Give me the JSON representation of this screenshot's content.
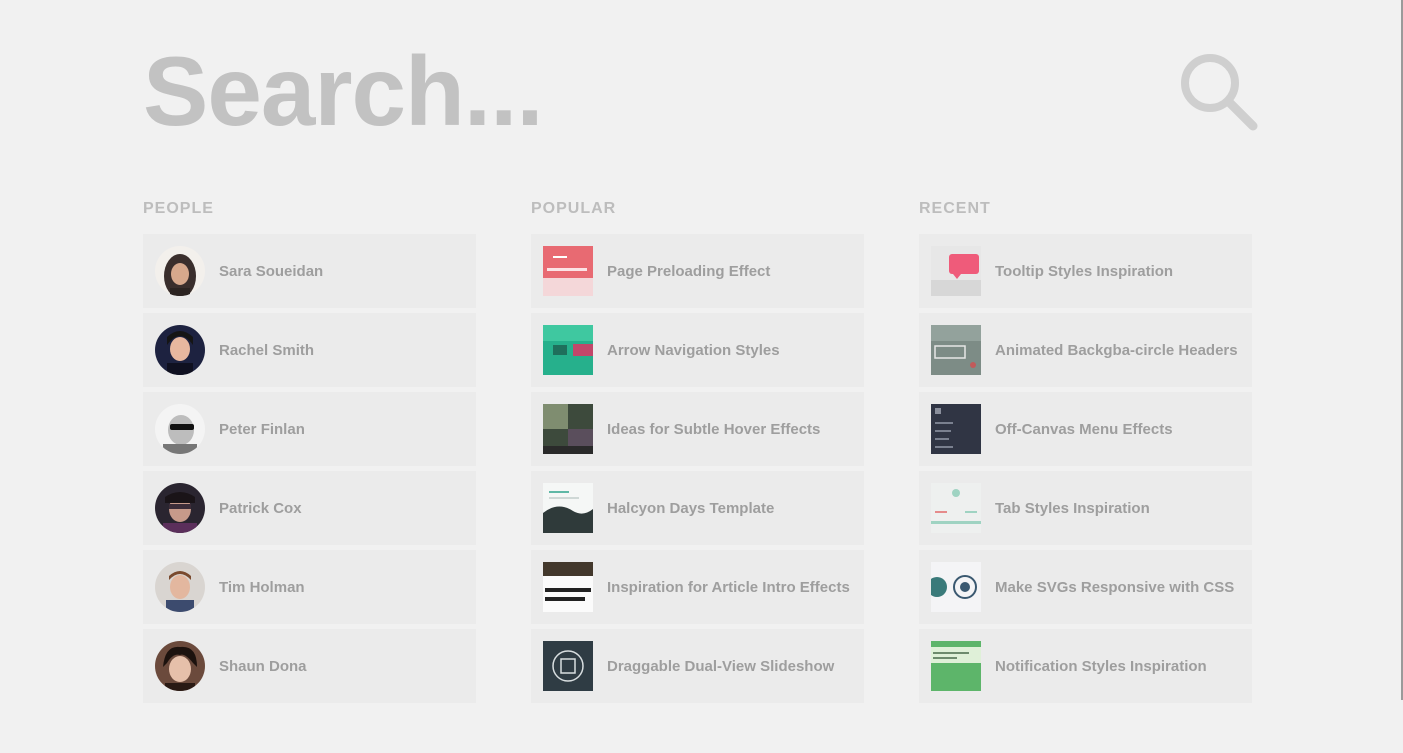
{
  "search": {
    "placeholder": "Search..."
  },
  "columns": [
    {
      "title": "PEOPLE",
      "items": [
        {
          "label": "Sara Soueidan",
          "thumb": "avatar-sara"
        },
        {
          "label": "Rachel Smith",
          "thumb": "avatar-rachel"
        },
        {
          "label": "Peter Finlan",
          "thumb": "avatar-peter"
        },
        {
          "label": "Patrick Cox",
          "thumb": "avatar-patrick"
        },
        {
          "label": "Tim Holman",
          "thumb": "avatar-tim"
        },
        {
          "label": "Shaun Dona",
          "thumb": "avatar-shaun"
        }
      ]
    },
    {
      "title": "POPULAR",
      "items": [
        {
          "label": "Page Preloading Effect",
          "thumb": "thumb-page-preloading"
        },
        {
          "label": "Arrow Navigation Styles",
          "thumb": "thumb-arrow-navigation"
        },
        {
          "label": "Ideas for Subtle Hover Effects",
          "thumb": "thumb-hover-effects"
        },
        {
          "label": "Halcyon Days Template",
          "thumb": "thumb-halcyon"
        },
        {
          "label": "Inspiration for Article Intro Effects",
          "thumb": "thumb-article-intro"
        },
        {
          "label": "Draggable Dual-View Slideshow",
          "thumb": "thumb-dual-view"
        }
      ]
    },
    {
      "title": "RECENT",
      "items": [
        {
          "label": "Tooltip Styles Inspiration",
          "thumb": "thumb-tooltip"
        },
        {
          "label": "Animated Backgba-circle Headers",
          "thumb": "thumb-animated-headers"
        },
        {
          "label": "Off-Canvas Menu Effects",
          "thumb": "thumb-off-canvas"
        },
        {
          "label": "Tab Styles Inspiration",
          "thumb": "thumb-tab-styles"
        },
        {
          "label": "Make SVGs Responsive with CSS",
          "thumb": "thumb-svg-responsive"
        },
        {
          "label": "Notification Styles Inspiration",
          "thumb": "thumb-notification"
        }
      ]
    }
  ],
  "colors": {
    "background": "#f1f1f1",
    "item_background": "#ebebeb",
    "text": "#9e9e9e",
    "search_text": "#c2c2c2"
  }
}
